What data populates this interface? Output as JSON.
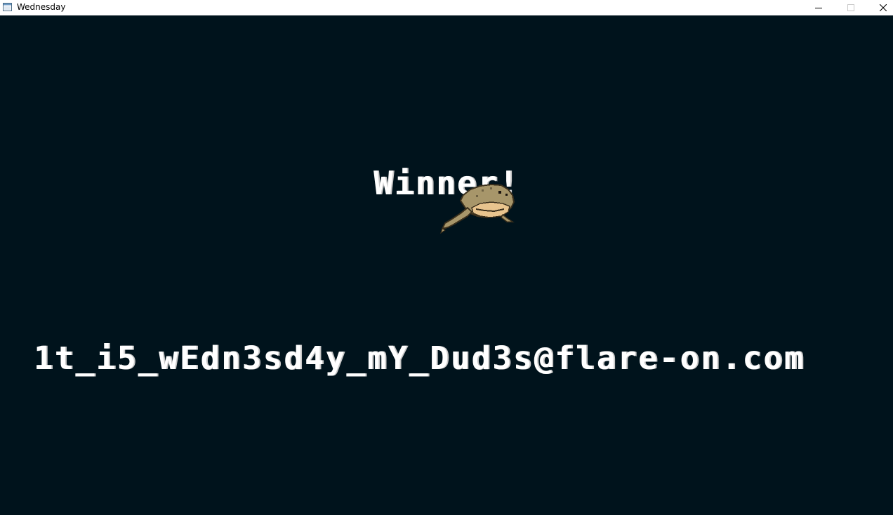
{
  "window": {
    "title": "Wednesday",
    "icon": "app-window-icon",
    "controls": {
      "minimize": "minimize-icon",
      "maximize": "maximize-icon",
      "close": "close-icon"
    }
  },
  "game": {
    "background_color": "#00131c",
    "text_color": "#ffffff",
    "winner_text": "Winner!",
    "flag_text": "1t_i5_wEdn3sd4y_mY_Dud3s@flare-on.com",
    "sprite": "frog-sprite"
  }
}
